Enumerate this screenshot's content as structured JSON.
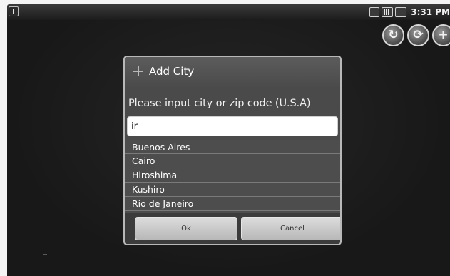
{
  "status_bar": {
    "left_icon": "usb-icon",
    "right_icons": [
      "sd-card-icon",
      "signal-icon",
      "battery-icon"
    ],
    "time": "3:31 PM"
  },
  "toolbar": {
    "buttons": [
      {
        "icon": "refresh-icon",
        "glyph": "↻"
      },
      {
        "icon": "sync-icon",
        "glyph": "⟳"
      },
      {
        "icon": "add-icon",
        "glyph": "+"
      }
    ]
  },
  "dialog": {
    "title": "Add City",
    "title_icon": "plus-icon",
    "message": "Please input city or zip code (U.S.A)",
    "input_value": "ir",
    "suggestions": [
      "Buenos Aires",
      "Cairo",
      "Hiroshima",
      "Kushiro",
      "Rio de Janeiro"
    ],
    "ok_label": "Ok",
    "cancel_label": "Cancel"
  },
  "colors": {
    "app_background": "#1b1b1b",
    "dialog_background": "#4a4a4a",
    "button_face": "#d0d0d0"
  }
}
